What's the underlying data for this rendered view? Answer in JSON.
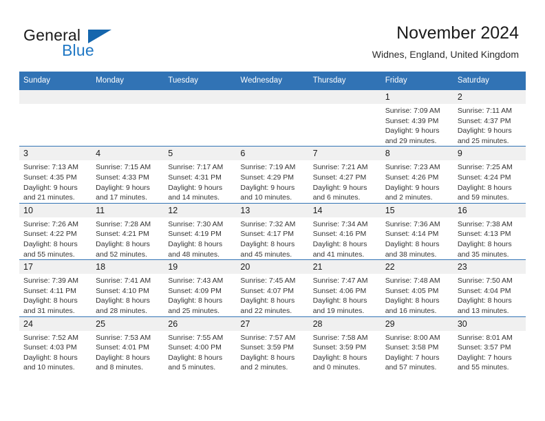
{
  "brand": {
    "name_part1": "General",
    "name_part2": "Blue",
    "triangle_color": "#1566ad",
    "blue_color": "#1f77c4"
  },
  "header": {
    "month_title": "November 2024",
    "location": "Widnes, England, United Kingdom"
  },
  "theme": {
    "header_bar_color": "#3173b5",
    "daynum_band_color": "#f0f0f0",
    "grid_line_color": "#3173b5",
    "text_color": "#333333"
  },
  "calendar": {
    "weekday_headers": [
      "Sunday",
      "Monday",
      "Tuesday",
      "Wednesday",
      "Thursday",
      "Friday",
      "Saturday"
    ],
    "weeks": [
      [
        {
          "day": "",
          "lines": []
        },
        {
          "day": "",
          "lines": []
        },
        {
          "day": "",
          "lines": []
        },
        {
          "day": "",
          "lines": []
        },
        {
          "day": "",
          "lines": []
        },
        {
          "day": "1",
          "lines": [
            "Sunrise: 7:09 AM",
            "Sunset: 4:39 PM",
            "Daylight: 9 hours",
            "and 29 minutes."
          ]
        },
        {
          "day": "2",
          "lines": [
            "Sunrise: 7:11 AM",
            "Sunset: 4:37 PM",
            "Daylight: 9 hours",
            "and 25 minutes."
          ]
        }
      ],
      [
        {
          "day": "3",
          "lines": [
            "Sunrise: 7:13 AM",
            "Sunset: 4:35 PM",
            "Daylight: 9 hours",
            "and 21 minutes."
          ]
        },
        {
          "day": "4",
          "lines": [
            "Sunrise: 7:15 AM",
            "Sunset: 4:33 PM",
            "Daylight: 9 hours",
            "and 17 minutes."
          ]
        },
        {
          "day": "5",
          "lines": [
            "Sunrise: 7:17 AM",
            "Sunset: 4:31 PM",
            "Daylight: 9 hours",
            "and 14 minutes."
          ]
        },
        {
          "day": "6",
          "lines": [
            "Sunrise: 7:19 AM",
            "Sunset: 4:29 PM",
            "Daylight: 9 hours",
            "and 10 minutes."
          ]
        },
        {
          "day": "7",
          "lines": [
            "Sunrise: 7:21 AM",
            "Sunset: 4:27 PM",
            "Daylight: 9 hours",
            "and 6 minutes."
          ]
        },
        {
          "day": "8",
          "lines": [
            "Sunrise: 7:23 AM",
            "Sunset: 4:26 PM",
            "Daylight: 9 hours",
            "and 2 minutes."
          ]
        },
        {
          "day": "9",
          "lines": [
            "Sunrise: 7:25 AM",
            "Sunset: 4:24 PM",
            "Daylight: 8 hours",
            "and 59 minutes."
          ]
        }
      ],
      [
        {
          "day": "10",
          "lines": [
            "Sunrise: 7:26 AM",
            "Sunset: 4:22 PM",
            "Daylight: 8 hours",
            "and 55 minutes."
          ]
        },
        {
          "day": "11",
          "lines": [
            "Sunrise: 7:28 AM",
            "Sunset: 4:21 PM",
            "Daylight: 8 hours",
            "and 52 minutes."
          ]
        },
        {
          "day": "12",
          "lines": [
            "Sunrise: 7:30 AM",
            "Sunset: 4:19 PM",
            "Daylight: 8 hours",
            "and 48 minutes."
          ]
        },
        {
          "day": "13",
          "lines": [
            "Sunrise: 7:32 AM",
            "Sunset: 4:17 PM",
            "Daylight: 8 hours",
            "and 45 minutes."
          ]
        },
        {
          "day": "14",
          "lines": [
            "Sunrise: 7:34 AM",
            "Sunset: 4:16 PM",
            "Daylight: 8 hours",
            "and 41 minutes."
          ]
        },
        {
          "day": "15",
          "lines": [
            "Sunrise: 7:36 AM",
            "Sunset: 4:14 PM",
            "Daylight: 8 hours",
            "and 38 minutes."
          ]
        },
        {
          "day": "16",
          "lines": [
            "Sunrise: 7:38 AM",
            "Sunset: 4:13 PM",
            "Daylight: 8 hours",
            "and 35 minutes."
          ]
        }
      ],
      [
        {
          "day": "17",
          "lines": [
            "Sunrise: 7:39 AM",
            "Sunset: 4:11 PM",
            "Daylight: 8 hours",
            "and 31 minutes."
          ]
        },
        {
          "day": "18",
          "lines": [
            "Sunrise: 7:41 AM",
            "Sunset: 4:10 PM",
            "Daylight: 8 hours",
            "and 28 minutes."
          ]
        },
        {
          "day": "19",
          "lines": [
            "Sunrise: 7:43 AM",
            "Sunset: 4:09 PM",
            "Daylight: 8 hours",
            "and 25 minutes."
          ]
        },
        {
          "day": "20",
          "lines": [
            "Sunrise: 7:45 AM",
            "Sunset: 4:07 PM",
            "Daylight: 8 hours",
            "and 22 minutes."
          ]
        },
        {
          "day": "21",
          "lines": [
            "Sunrise: 7:47 AM",
            "Sunset: 4:06 PM",
            "Daylight: 8 hours",
            "and 19 minutes."
          ]
        },
        {
          "day": "22",
          "lines": [
            "Sunrise: 7:48 AM",
            "Sunset: 4:05 PM",
            "Daylight: 8 hours",
            "and 16 minutes."
          ]
        },
        {
          "day": "23",
          "lines": [
            "Sunrise: 7:50 AM",
            "Sunset: 4:04 PM",
            "Daylight: 8 hours",
            "and 13 minutes."
          ]
        }
      ],
      [
        {
          "day": "24",
          "lines": [
            "Sunrise: 7:52 AM",
            "Sunset: 4:03 PM",
            "Daylight: 8 hours",
            "and 10 minutes."
          ]
        },
        {
          "day": "25",
          "lines": [
            "Sunrise: 7:53 AM",
            "Sunset: 4:01 PM",
            "Daylight: 8 hours",
            "and 8 minutes."
          ]
        },
        {
          "day": "26",
          "lines": [
            "Sunrise: 7:55 AM",
            "Sunset: 4:00 PM",
            "Daylight: 8 hours",
            "and 5 minutes."
          ]
        },
        {
          "day": "27",
          "lines": [
            "Sunrise: 7:57 AM",
            "Sunset: 3:59 PM",
            "Daylight: 8 hours",
            "and 2 minutes."
          ]
        },
        {
          "day": "28",
          "lines": [
            "Sunrise: 7:58 AM",
            "Sunset: 3:59 PM",
            "Daylight: 8 hours",
            "and 0 minutes."
          ]
        },
        {
          "day": "29",
          "lines": [
            "Sunrise: 8:00 AM",
            "Sunset: 3:58 PM",
            "Daylight: 7 hours",
            "and 57 minutes."
          ]
        },
        {
          "day": "30",
          "lines": [
            "Sunrise: 8:01 AM",
            "Sunset: 3:57 PM",
            "Daylight: 7 hours",
            "and 55 minutes."
          ]
        }
      ]
    ]
  }
}
